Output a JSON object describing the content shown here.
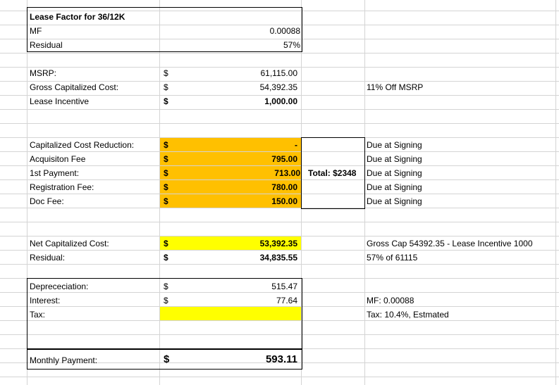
{
  "sheet": {
    "header": {
      "title": "Lease Factor for 36/12K",
      "mf_label": "MF",
      "mf_value": "0.00088",
      "residual_label": "Residual",
      "residual_value": "57%"
    },
    "currency_symbol": "$",
    "pricing": {
      "msrp_label": "MSRP:",
      "msrp_value": "61,115.00",
      "gross_cap_label": "Gross Capitalized Cost:",
      "gross_cap_value": "54,392.35",
      "gross_cap_note": "11% Off MSRP",
      "incentive_label": "Lease Incentive",
      "incentive_value": "1,000.00"
    },
    "signing": {
      "total_label": "Total: $2348",
      "rows": [
        {
          "label": "Capitalized Cost Reduction:",
          "value": "-",
          "note": "Due at Signing"
        },
        {
          "label": "Acquisiton Fee",
          "value": "795.00",
          "note": "Due at Signing"
        },
        {
          "label": "1st Payment:",
          "value": "713.00",
          "note": "Due at Signing"
        },
        {
          "label": "Registration Fee:",
          "value": "780.00",
          "note": "Due at Signing"
        },
        {
          "label": "Doc Fee:",
          "value": "150.00",
          "note": "Due at Signing"
        }
      ]
    },
    "net": {
      "net_cap_label": "Net Capitalized Cost:",
      "net_cap_value": "53,392.35",
      "net_cap_note": "Gross Cap 54392.35 - Lease Incentive 1000",
      "residual_label": "Residual:",
      "residual_value": "34,835.55",
      "residual_note": "57% of 61115"
    },
    "payment": {
      "depreciation_label": "Deprececiation:",
      "depreciation_value": "515.47",
      "interest_label": "Interest:",
      "interest_value": "77.64",
      "interest_note": "MF: 0.00088",
      "tax_label": "Tax:",
      "tax_note": "Tax: 10.4%, Estmated",
      "monthly_label": "Monthly Payment:",
      "monthly_value": "593.11"
    },
    "colors": {
      "orange_fill": "#ffc000",
      "yellow_fill": "#ffff00",
      "gridline": "#d4d4d4"
    }
  }
}
